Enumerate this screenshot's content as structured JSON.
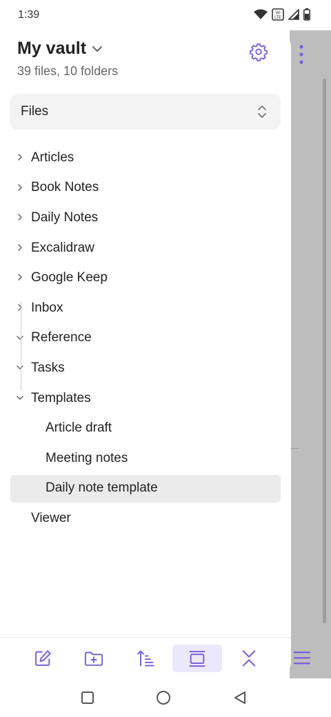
{
  "status_bar": {
    "time": "1:39"
  },
  "vault": {
    "title": "My vault",
    "summary": "39 files, 10 folders"
  },
  "view_selector": {
    "selected": "Files"
  },
  "tree": [
    {
      "label": "Articles",
      "type": "folder",
      "expanded": false
    },
    {
      "label": "Book Notes",
      "type": "folder",
      "expanded": false
    },
    {
      "label": "Daily Notes",
      "type": "folder",
      "expanded": false
    },
    {
      "label": "Excalidraw",
      "type": "folder",
      "expanded": false
    },
    {
      "label": "Google Keep",
      "type": "folder",
      "expanded": false
    },
    {
      "label": "Inbox",
      "type": "folder",
      "expanded": false
    },
    {
      "label": "Reference",
      "type": "folder",
      "expanded": true
    },
    {
      "label": "Tasks",
      "type": "folder",
      "expanded": true
    },
    {
      "label": "Templates",
      "type": "folder",
      "expanded": true
    },
    {
      "label": "Article draft",
      "type": "file",
      "parent": "Templates"
    },
    {
      "label": "Meeting notes",
      "type": "file",
      "parent": "Templates"
    },
    {
      "label": "Daily note template",
      "type": "file",
      "parent": "Templates",
      "selected": true
    },
    {
      "label": "Viewer",
      "type": "file"
    }
  ],
  "toolbar": {
    "buttons": [
      "new-note-icon",
      "new-folder-icon",
      "sort-icon",
      "collapse-view-icon",
      "collapse-all-icon"
    ],
    "active": "collapse-view-icon"
  },
  "colors": {
    "accent": "#7b61d6",
    "selected_bg": "#ebebeb",
    "overlay": "#bdbdbd"
  }
}
